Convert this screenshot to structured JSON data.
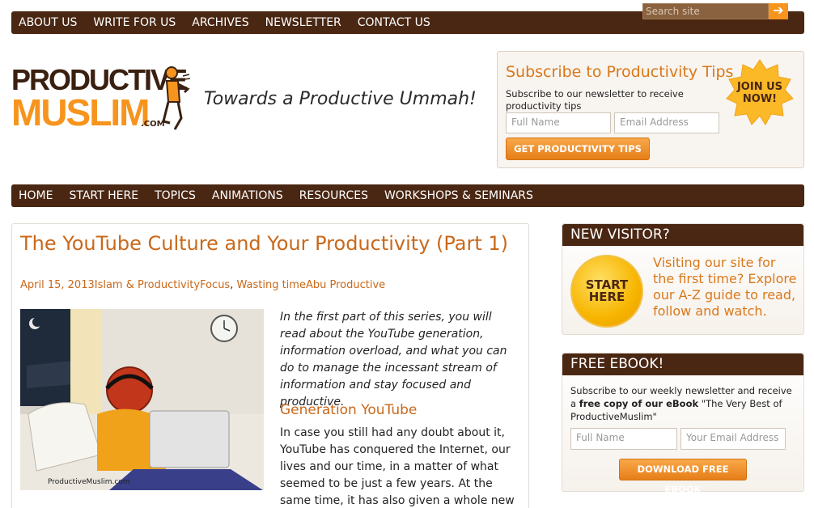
{
  "topnav": {
    "items": [
      "ABOUT US",
      "WRITE FOR US",
      "ARCHIVES",
      "NEWSLETTER",
      "CONTACT US"
    ],
    "search_placeholder": "Search site",
    "search_arrow": "➔"
  },
  "logo": {
    "line1": "PRODUCTIVE",
    "line2": "MUSLIM",
    "com": ".COM"
  },
  "tagline": "Towards a Productive Ummah!",
  "subscribe": {
    "title": "Subscribe to Productivity Tips",
    "text": "Subscribe to our newsletter to receive productivity tips",
    "name_placeholder": "Full Name",
    "email_placeholder": "Email Address",
    "button": "GET PRODUCTIVITY TIPS",
    "star_line1": "JOIN US",
    "star_line2": "NOW!"
  },
  "mainnav": {
    "items": [
      "HOME",
      "START HERE",
      "TOPICS",
      "ANIMATIONS",
      "RESOURCES",
      "WORKSHOPS & SEMINARS"
    ]
  },
  "article": {
    "title": "The YouTube Culture and Your Productivity (Part 1)",
    "date": "April 15, 2013",
    "category": "Islam & Productivity",
    "tag1": "Focus",
    "tag2": "Wasting time",
    "author": "Abu Productive",
    "meta_sep": ", ",
    "image_caption": "ProductiveMuslim.com",
    "intro": "In the first part of this series, you will read about the YouTube generation, information overload, and what you can do to manage the incessant stream of information and stay focused and productive.",
    "section_heading": "Generation YouTube",
    "body": "In case you still had any doubt about it, YouTube has conquered the Internet, our lives and our time, in a matter of what seemed to be just a few years. At the same time, it has also given a whole new dimension to sharing"
  },
  "new_visitor": {
    "heading": "NEW VISITOR?",
    "circle_line1": "START",
    "circle_line2": "HERE",
    "text": "Visiting our site for the first time? Explore our A-Z guide to read, follow and watch."
  },
  "free_ebook": {
    "heading": "FREE EBOOK!",
    "text_a": "Subscribe to our weekly newsletter and receive a ",
    "text_bold": "free copy of our eBook",
    "text_b": " \"The Very Best of ProductiveMuslim\"",
    "name_placeholder": "Full Name",
    "email_placeholder": "Your Email Address",
    "button": "DOWNLOAD FREE EBOOK"
  },
  "colors": {
    "brown": "#4a2713",
    "orange": "#f7941d",
    "link_orange": "#c9681a"
  }
}
